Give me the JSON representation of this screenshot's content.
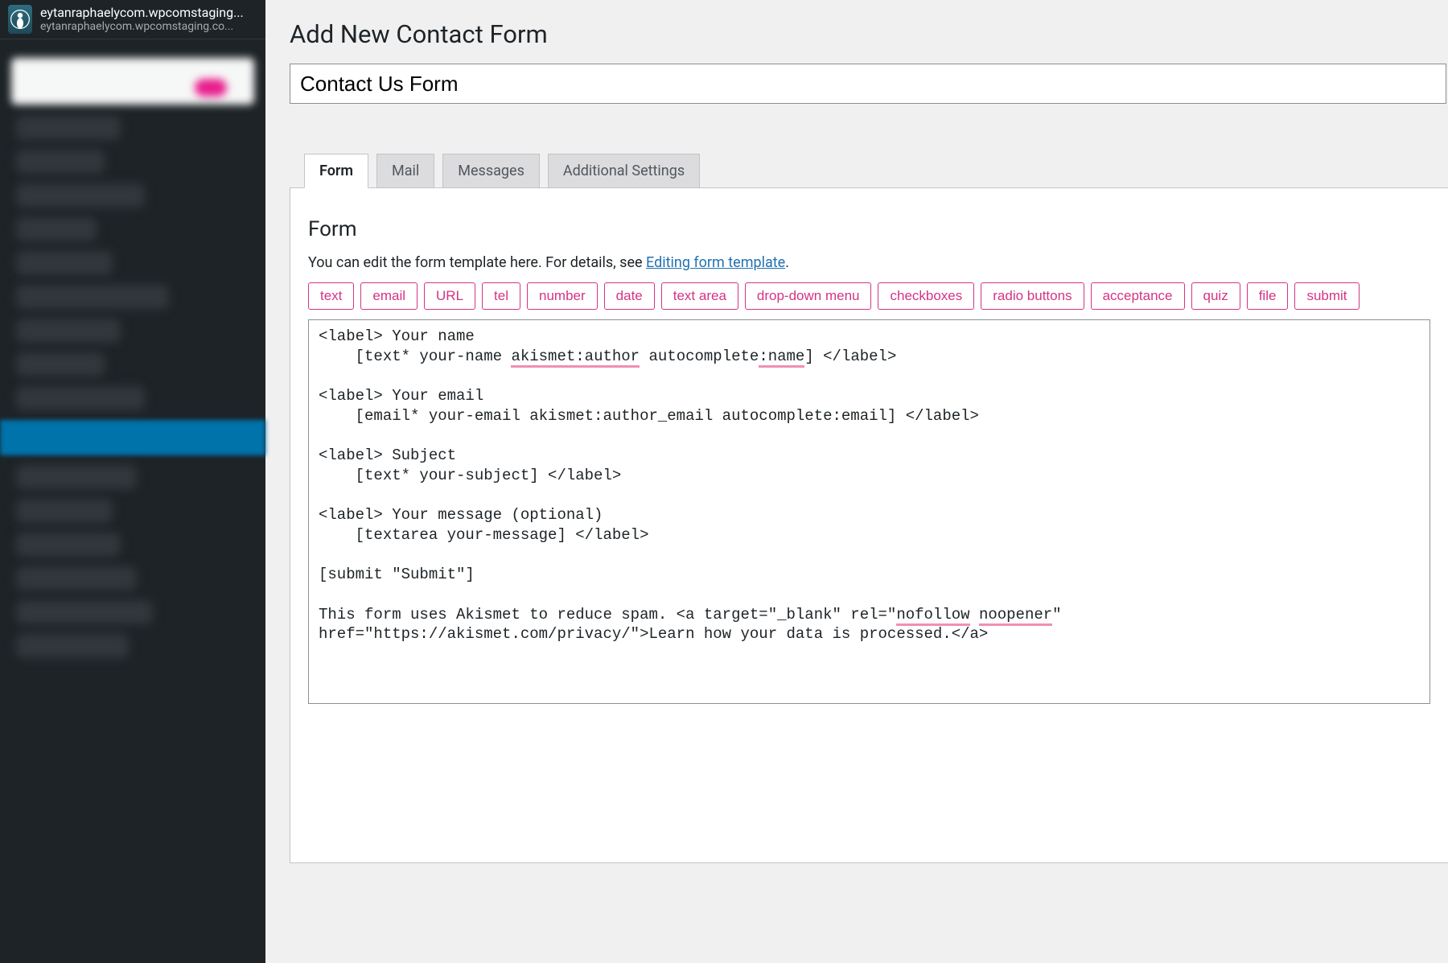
{
  "site": {
    "name": "eytanraphaelycom.wpcomstaging...",
    "sub": "eytanraphaelycom.wpcomstaging.co..."
  },
  "page": {
    "title": "Add New Contact Form",
    "title_input": "Contact Us Form"
  },
  "tabs": [
    {
      "label": "Form",
      "active": true
    },
    {
      "label": "Mail",
      "active": false
    },
    {
      "label": "Messages",
      "active": false
    },
    {
      "label": "Additional Settings",
      "active": false
    }
  ],
  "form_panel": {
    "heading": "Form",
    "help_prefix": "You can edit the form template here. For details, see ",
    "help_link": "Editing form template",
    "help_suffix": "."
  },
  "tag_buttons": [
    "text",
    "email",
    "URL",
    "tel",
    "number",
    "date",
    "text area",
    "drop-down menu",
    "checkboxes",
    "radio buttons",
    "acceptance",
    "quiz",
    "file",
    "submit"
  ],
  "code_lines": {
    "l1a": "<label> Your name",
    "l2a": "    [text* your-name ",
    "l2u": "akismet:author",
    "l2b": " autocomplete",
    "l2u2": ":name",
    "l2c": "] </label>",
    "blank1": "",
    "l3a": "<label> Your email",
    "l4a": "    [email* your-email akismet:author_email autocomplete:email] </label>",
    "blank2": "",
    "l5a": "<label> Subject",
    "l6a": "    [text* your-subject] </label>",
    "blank3": "",
    "l7a": "<label> Your message (optional)",
    "l8a": "    [textarea your-message] </label>",
    "blank4": "",
    "l9a": "[submit \"Submit\"]",
    "blank5": "",
    "l10a": "This form uses Akismet to reduce spam. <a target=\"_blank\" rel=\"",
    "l10u": "nofollow",
    "l10b": " ",
    "l10u2": "noopener",
    "l10c": "\" href=\"https://akismet.com/privacy/\">Learn how your data is processed.</a>"
  }
}
